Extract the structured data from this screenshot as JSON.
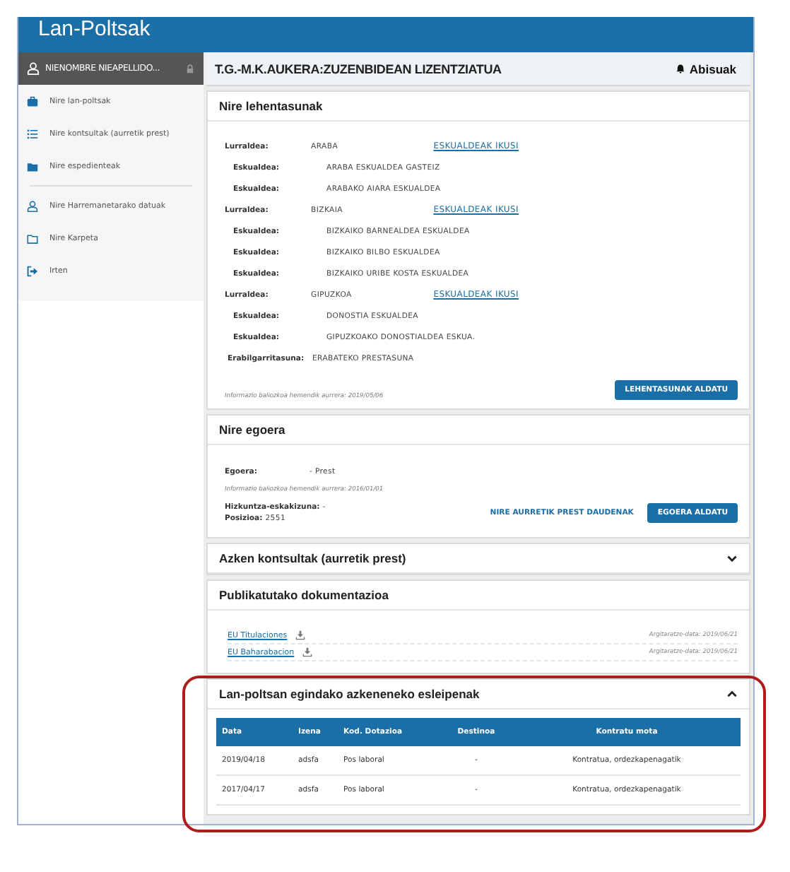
{
  "header": {
    "title": "Lan-Poltsak"
  },
  "user": {
    "name": "NIENOMBRE NIEAPELLIDO..."
  },
  "sidebar": {
    "groups": [
      [
        {
          "label": "Nire lan-poltsak",
          "kind": "briefcase"
        },
        {
          "label": "Nire kontsultak (aurretik prest)",
          "kind": "list"
        },
        {
          "label": "Nire espedienteak",
          "kind": "folder"
        }
      ],
      [
        {
          "label": "Nire Harremanetarako datuak",
          "kind": "user"
        },
        {
          "label": "Nire Karpeta",
          "kind": "folder-outline"
        },
        {
          "label": "Irten",
          "kind": "exit"
        }
      ]
    ]
  },
  "topbar": {
    "title": "T.G.-M.K.AUKERA:ZUZENBIDEAN LIZENTZIATUA",
    "notifications": "Abisuak"
  },
  "preferences": {
    "title": "Nire lehentasunak",
    "regions": [
      {
        "label": "Lurraldea:",
        "value": "ARABA",
        "link": "ESKUALDEAK IKUSI",
        "districts": [
          {
            "label": "Eskualdea:",
            "value": "ARABA ESKUALDEA GASTEIZ"
          },
          {
            "label": "Eskualdea:",
            "value": "ARABAKO AIARA ESKUALDEA"
          }
        ]
      },
      {
        "label": "Lurraldea:",
        "value": "BIZKAIA",
        "link": "ESKUALDEAK IKUSI",
        "districts": [
          {
            "label": "Eskualdea:",
            "value": "BIZKAIKO BARNEALDEA ESKUALDEA"
          },
          {
            "label": "Eskualdea:",
            "value": "BIZKAIKO BILBO ESKUALDEA"
          },
          {
            "label": "Eskualdea:",
            "value": "BIZKAIKO URIBE KOSTA ESKUALDEA"
          }
        ]
      },
      {
        "label": "Lurraldea:",
        "value": "GIPUZKOA",
        "link": "ESKUALDEAK IKUSI",
        "districts": [
          {
            "label": "Eskualdea:",
            "value": "DONOSTIA ESKUALDEA"
          },
          {
            "label": "Eskualdea:",
            "value": "GIPUZKOAKO DONOSTIALDEA ESKUA."
          }
        ]
      }
    ],
    "availability": {
      "label": "Erabilgarritasuna:",
      "value": "ERABATEKO PRESTASUNA"
    },
    "note": "Informazio baliozkoa hemendik aurrera: 2019/05/06",
    "button": "LEHENTASUNAK ALDATU"
  },
  "status": {
    "title": "Nire egoera",
    "state": {
      "label": "Egoera:",
      "value": "- Prest"
    },
    "note": "Informazio baliozkoa hemendik aurrera: 2016/01/01",
    "language": {
      "label": "Hizkuntza-eskakizuna:",
      "value": "-"
    },
    "position": {
      "label": "Posizioa:",
      "value": "2551"
    },
    "link": "NIRE AURRETIK PREST DAUDENAK",
    "button": "EGOERA ALDATU"
  },
  "recent": {
    "title": "Azken kontsultak (aurretik prest)",
    "expanded": false
  },
  "documents": {
    "title": "Publikatutako dokumentazioa",
    "items": [
      {
        "name": "EU Titulaciones",
        "date": "Argitaratze-data: 2019/06/21"
      },
      {
        "name": "EU Baharabacion",
        "date": "Argitaratze-data: 2019/06/21"
      }
    ]
  },
  "assignments": {
    "title": "Lan-poltsan egindako azkeneneko esleipenak",
    "expanded": true,
    "columns": [
      "Data",
      "Izena",
      "Kod. Dotazioa",
      "Destinoa",
      "Kontratu mota"
    ],
    "rows": [
      [
        "2019/04/18",
        "adsfa",
        "Pos laboral",
        "-",
        "Kontratua, ordezkapenagatik"
      ],
      [
        "2017/04/17",
        "adsfa",
        "Pos laboral",
        "-",
        "Kontratua, ordezkapenagatik"
      ]
    ]
  }
}
